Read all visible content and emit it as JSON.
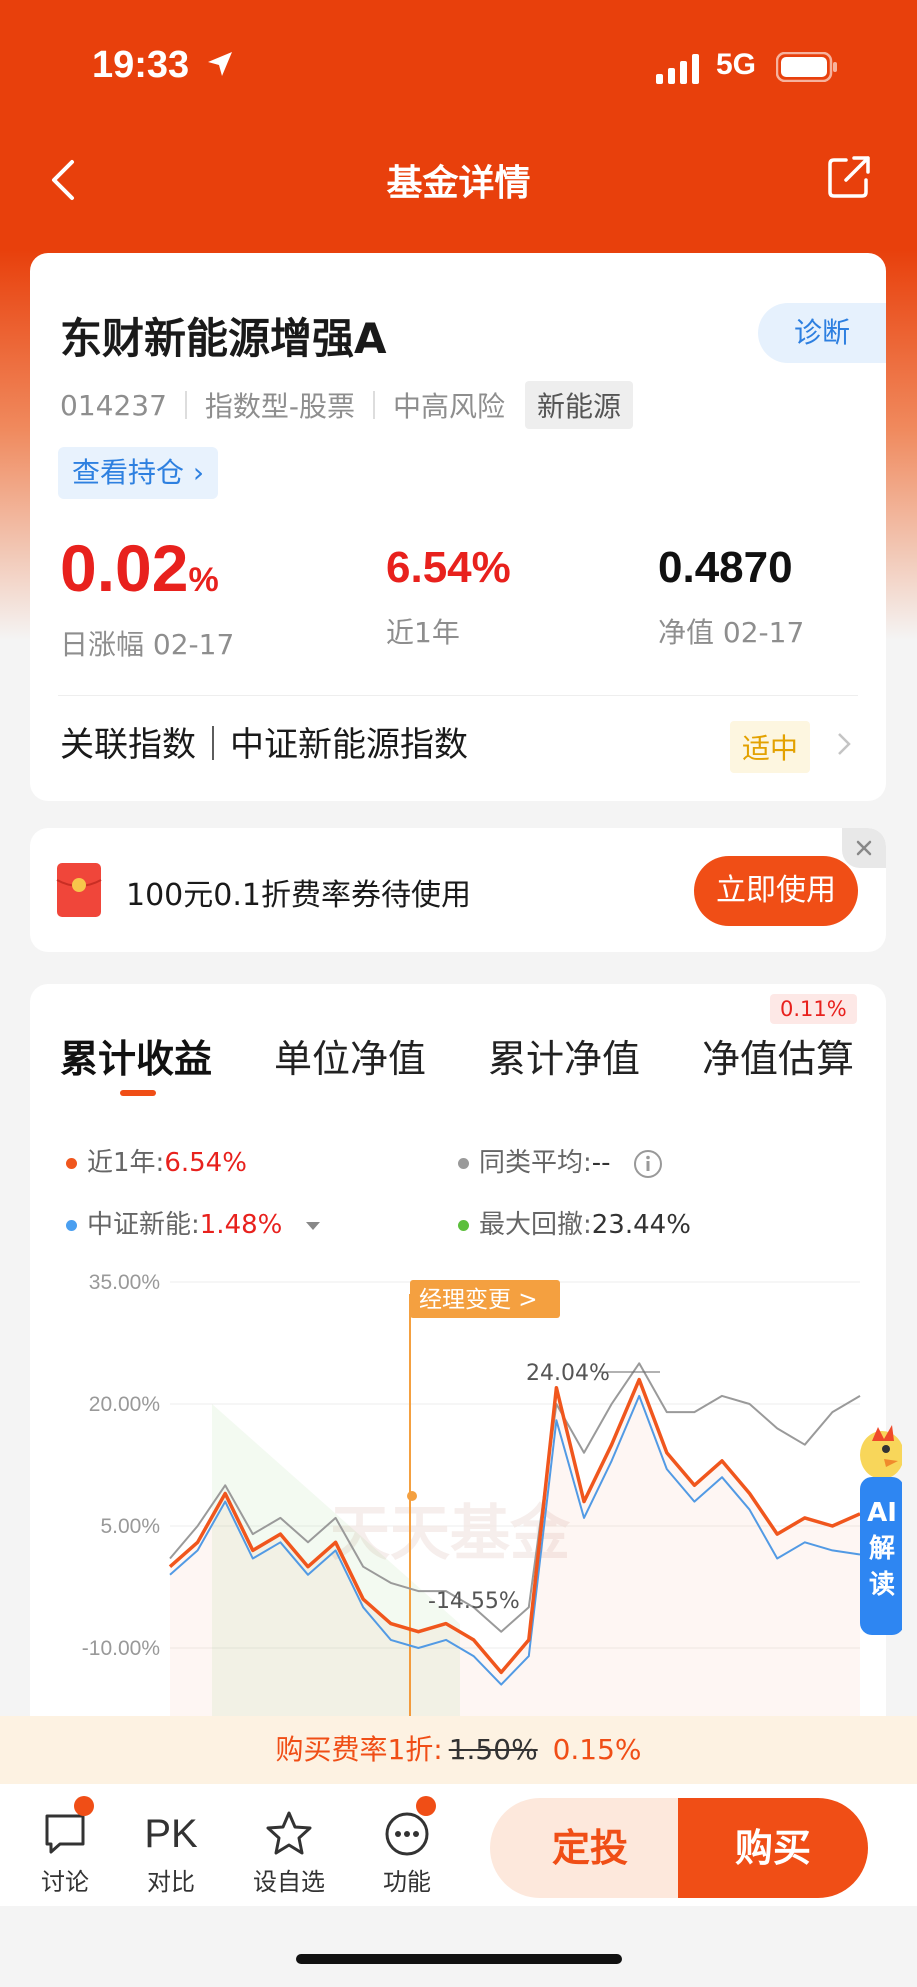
{
  "status_bar": {
    "time": "19:33",
    "network": "5G"
  },
  "nav": {
    "title": "基金详情"
  },
  "fund": {
    "name": "东财新能源增强A",
    "code": "014237",
    "type": "指数型-股票",
    "risk": "中高风险",
    "sector_tag": "新能源",
    "diagnose_label": "诊断",
    "holdings_label": "查看持仓",
    "daily_change": "0.02",
    "daily_change_unit": "%",
    "daily_label": "日涨幅 02-17",
    "year_return": "6.54%",
    "year_label": "近1年",
    "nav_value": "0.4870",
    "nav_label": "净值 02-17",
    "related_index": "关联指数｜中证新能源指数",
    "valuation_level": "适中"
  },
  "coupon": {
    "text": "100元0.1折费率券待使用",
    "button": "立即使用"
  },
  "chart_tabs": {
    "t1": "累计收益",
    "t2": "单位净值",
    "t3": "累计净值",
    "t4": "净值估算",
    "t4_badge": "0.11%"
  },
  "legend": {
    "l1_name": "近1年:",
    "l1_value": "6.54%",
    "l2_name": "同类平均:",
    "l2_value": "--",
    "l3_name": "中证新能:",
    "l3_value": "1.48%",
    "l4_name": "最大回撤:",
    "l4_value": "23.44%"
  },
  "chart_overlay": {
    "y_ticks": [
      "35.00%",
      "20.00%",
      "5.00%",
      "-10.00%"
    ],
    "manager_change": "经理变更 >",
    "peak_label": "24.04%",
    "trough_label": "-14.55%",
    "watermark": "天天基金",
    "ai_label": "AI解读"
  },
  "colors": {
    "fund": "#f0561d",
    "category_avg": "#9a9a9a",
    "index": "#4a9ff0",
    "drawdown": "#5cbf3c",
    "accent": "#f04e16"
  },
  "chart_data": {
    "type": "line",
    "ylim": [
      -14.55,
      24.04
    ],
    "y_ticks": [
      "35.00%",
      "20.00%",
      "5.00%",
      "-10.00%"
    ],
    "series": [
      {
        "name": "近1年",
        "values": [
          0,
          3,
          9,
          2,
          4,
          0,
          3,
          -4,
          -7,
          -8,
          -7,
          -9,
          -13,
          -9,
          22,
          8,
          15,
          23,
          14,
          10,
          13,
          9,
          4,
          6,
          5,
          6.5
        ]
      },
      {
        "name": "同类平均",
        "values": [
          1,
          5,
          10,
          4,
          6,
          3,
          6,
          0,
          -2,
          -3,
          -3,
          -5,
          -8,
          -5,
          20,
          14,
          20,
          25,
          19,
          19,
          21,
          20,
          17,
          15,
          19,
          21
        ]
      },
      {
        "name": "中证新能",
        "values": [
          -1,
          2,
          8,
          1,
          3,
          -1,
          2,
          -5,
          -9,
          -10,
          -9,
          -11,
          -14.5,
          -11,
          18,
          6,
          13,
          21,
          12,
          8,
          11,
          7,
          1,
          3,
          2,
          1.5
        ]
      }
    ],
    "annotations": [
      "经理变更 >",
      "24.04%",
      "-14.55%"
    ]
  },
  "rate_bar": {
    "prefix": "购买费率1折:",
    "old": "1.50%",
    "new": "0.15%"
  },
  "bottom": {
    "discuss": "讨论",
    "pk_icon": "PK",
    "pk": "对比",
    "favorite": "设自选",
    "functions": "功能",
    "sip": "定投",
    "buy": "购买"
  }
}
